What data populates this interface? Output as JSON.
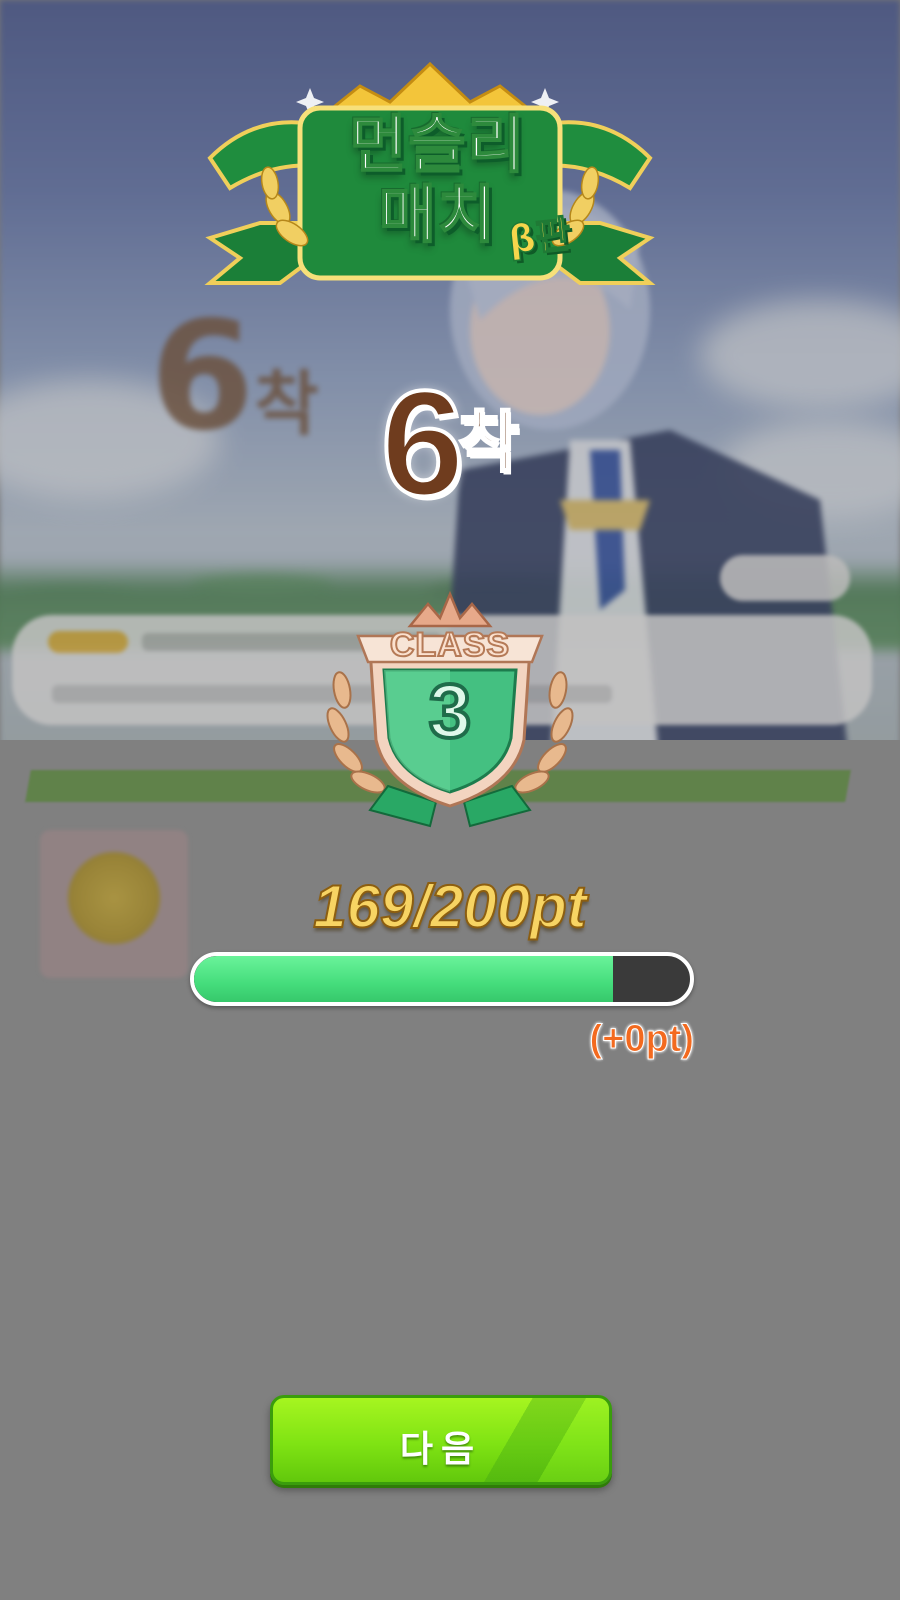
{
  "event": {
    "title_line1": "먼슬리",
    "title_line2": "매치",
    "beta": "β판"
  },
  "result": {
    "place_number": "6",
    "place_suffix": "착"
  },
  "class_badge": {
    "label": "CLASS",
    "level": "3"
  },
  "progress": {
    "points_text": "169/200pt",
    "current": 169,
    "max": 200,
    "gain_text": "(+0pt)"
  },
  "buttons": {
    "next_label": "다음"
  },
  "colors": {
    "progress_fill": "#45dd7c",
    "progress_track": "#3a3a3a",
    "gain_text": "#f36a1f",
    "button_green": "#7fe313",
    "place_brown": "#6f3c1e"
  }
}
